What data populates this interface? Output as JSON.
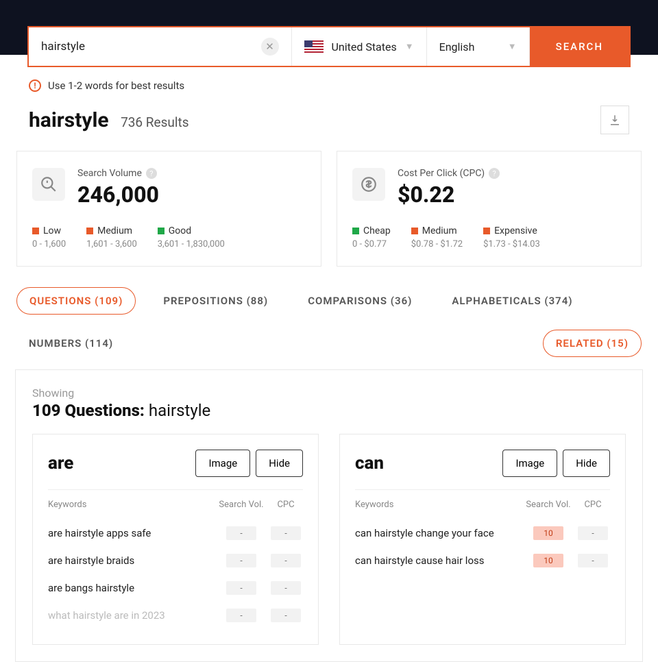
{
  "search": {
    "value": "hairstyle",
    "country": "United States",
    "language": "English",
    "button": "SEARCH"
  },
  "hint": "Use 1-2 words for best results",
  "header": {
    "term": "hairstyle",
    "results": "736 Results"
  },
  "volume": {
    "label": "Search Volume",
    "value": "246,000",
    "legend": [
      {
        "color": "o",
        "name": "Low",
        "range": "0 - 1,600"
      },
      {
        "color": "o",
        "name": "Medium",
        "range": "1,601 - 3,600"
      },
      {
        "color": "g",
        "name": "Good",
        "range": "3,601 - 1,830,000"
      }
    ]
  },
  "cpc": {
    "label": "Cost Per Click (CPC)",
    "value": "$0.22",
    "legend": [
      {
        "color": "g",
        "name": "Cheap",
        "range": "0 - $0.77"
      },
      {
        "color": "o",
        "name": "Medium",
        "range": "$0.78 - $1.72"
      },
      {
        "color": "o",
        "name": "Expensive",
        "range": "$1.73 - $14.03"
      }
    ]
  },
  "tabs": [
    {
      "label": "QUESTIONS (109)",
      "active": true
    },
    {
      "label": "PREPOSITIONS (88)"
    },
    {
      "label": "COMPARISONS (36)"
    },
    {
      "label": "ALPHABETICALS (374)"
    },
    {
      "label": "NUMBERS (114)"
    }
  ],
  "related": "RELATED (15)",
  "panel": {
    "showing": "Showing",
    "title_bold": "109 Questions:",
    "title_light": "hairstyle"
  },
  "cols": {
    "kw": "Keywords",
    "sv": "Search Vol.",
    "cpc": "CPC"
  },
  "buttons": {
    "image": "Image",
    "hide": "Hide"
  },
  "groups": [
    {
      "word": "are",
      "rows": [
        {
          "kw": "are hairstyle apps safe",
          "sv": "-",
          "cpc": "-"
        },
        {
          "kw": "are hairstyle braids",
          "sv": "-",
          "cpc": "-"
        },
        {
          "kw": "are bangs hairstyle",
          "sv": "-",
          "cpc": "-"
        },
        {
          "kw": "what hairstyle are in 2023",
          "sv": "-",
          "cpc": "-",
          "faded": true
        }
      ]
    },
    {
      "word": "can",
      "rows": [
        {
          "kw": "can hairstyle change your face",
          "sv": "10",
          "cpc": "-",
          "hot": true
        },
        {
          "kw": "can hairstyle cause hair loss",
          "sv": "10",
          "cpc": "-",
          "hot": true
        }
      ]
    }
  ]
}
